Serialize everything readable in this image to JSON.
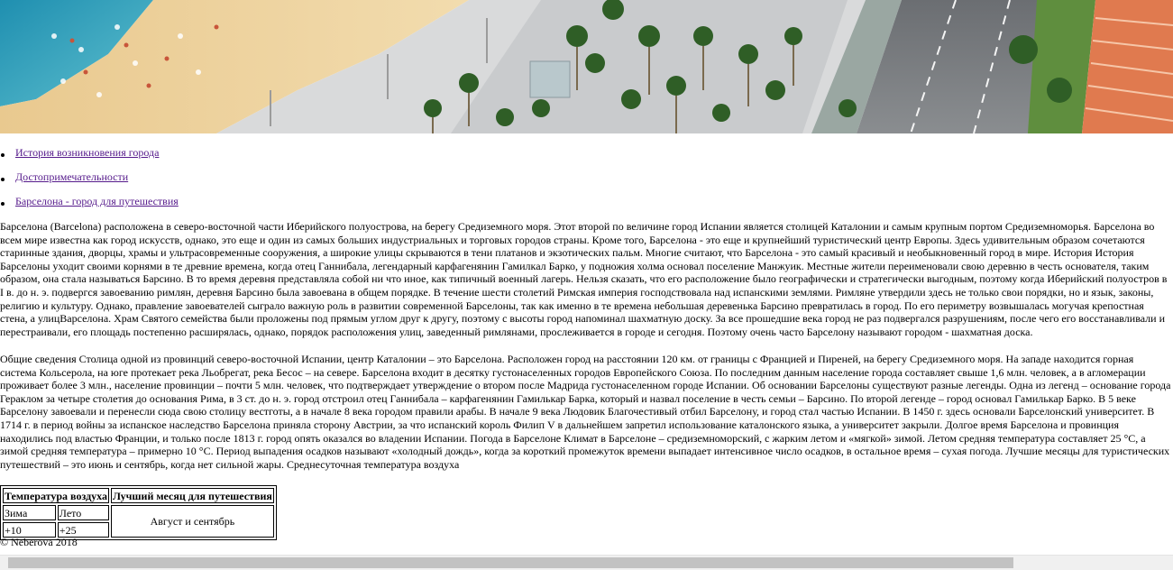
{
  "nav": {
    "items": [
      {
        "label": "История возникновения города"
      },
      {
        "label": "Достопримечательности"
      },
      {
        "label": "Барселона - город для путешествия"
      }
    ]
  },
  "content": {
    "paragraph1": "Барселона (Barcelona) расположена в северо-восточной части Иберийского полуострова, на берегу Средиземного моря. Этот второй по величине город Испании является столицей Каталонии и самым крупным портом Средиземноморья. Барселона во всем мире известна как город искусств, однако, это еще и один из самых больших индустриальных и торговых городов страны. Кроме того, Барселона - это еще и крупнейший туристический центр Европы. Здесь удивительным образом сочетаются старинные здания, дворцы, храмы и ультрасовременные сооружения, а широкие улицы скрываются в тени платанов и экзотических пальм. Многие считают, что Барселона - это самый красивый и необыкновенный город в мире. История История Барселоны уходит своими корнями в те древние времена, когда отец Ганнибала, легендарный карфагенянин Гамилкал Барко, у подножия холма основал поселение Манжуик. Местные жители переименовали свою деревню в честь основателя, таким образом, она стала называться Барсино. В то время деревня представляла собой ни что иное, как типичный военный лагерь. Нельзя сказать, что его расположение было географически и стратегически выгодным, поэтому когда Иберийский полуостров в I в. до н. э. подвергся завоеванию римлян, деревня Барсино была завоевана в общем порядке. В течение шести столетий Римская империя господствовала над испанскими землями. Римляне утвердили здесь не только свои порядки, но и язык, законы, религию и культуру. Однако, правление завоевателей сыграло важную роль в развитии современной Барселоны, так как именно в те времена небольшая деревенька Барсино превратилась в город. По его периметру возвышалась могучая крепостная стена, а улицBарселона. Храм Святого семейства были проложены под прямым углом друг к другу, поэтому с высоты город напоминал шахматную доску. За все прошедшие века город не раз подвергался разрушениям, после чего его восстанавливали и перестраивали, его площадь постепенно расширялась, однако, порядок расположения улиц, заведенный римлянами, прослеживается в городе и сегодня. Поэтому очень часто Барселону называют городом - шахматная доска.",
    "paragraph2": "Общие сведения Столица одной из провинций северо-восточной Испании, центр Каталонии – это Барселона. Расположен город на расстоянии 120 км. от границы с Францией и Пиреней, на берегу Средиземного моря. На западе находится горная система Кольсерола, на юге протекает река Льобрегат, река Бесос – на севере. Барселона входит в десятку густонаселенных городов Европейского Союза. По последним данным население города составляет свыше 1,6 млн. человек, а в агломерации проживает более 3 млн., население провинции – почти 5 млн. человек, что подтверждает утверждение о втором после Мадрида густонаселенном городе Испании. Об основании Барселоны существуют разные легенды. Одна из легенд – основание города Гераклом за четыре столетия до основания Рима, в 3 ст. до н. э. город отстроил отец Ганнибала – карфагенянин Гамилькар Барка, который и назвал поселение в честь семьи – Барсино. По второй легенде – город основал Гамилькар Барко. В 5 веке Барселону завоевали и перенесли сюда свою столицу вестготы, а в начале 8 века городом правили арабы. В начале 9 века Людовик Благочестивый отбил Барселону, и город стал частью Испании. В 1450 г. здесь основали Барселонский университет. В 1714 г. в период войны за испанское наследство Барселона приняла сторону Австрии, за что испанский король Филип V в дальнейшем запретил использование каталонского языка, а университет закрыли. Долгое время Барселона и провинция находились под властью Франции, и только после 1813 г. город опять оказался во владении Испании. Погода в Барселоне Климат в Барселоне – средиземноморский, с жарким летом и «мягкой» зимой. Летом средняя температура составляет 25 °С, а зимой средняя температура – примерно 10 °С. Период выпадения осадков называют «холодный дождь», когда за короткий промежуток времени выпадает интенсивное число осадков, в остальное время – сухая погода. Лучшие месяцы для туристических путешествий – это июнь и сентябрь, когда нет сильной жары. Среднесуточная температура воздуха"
  },
  "table": {
    "header_temp": "Температура воздуха",
    "header_best": "Лучший месяц для путешествия",
    "winter_label": "Зима",
    "summer_label": "Лето",
    "winter_value": "+10",
    "summer_value": "+25",
    "best_value": "Август и сентябрь"
  },
  "footer": {
    "text": "© Neberova 2018"
  },
  "colors": {
    "link": "#551a8b",
    "scroll_thumb": "#c2c2c2",
    "scroll_track": "#f0f0f0"
  }
}
